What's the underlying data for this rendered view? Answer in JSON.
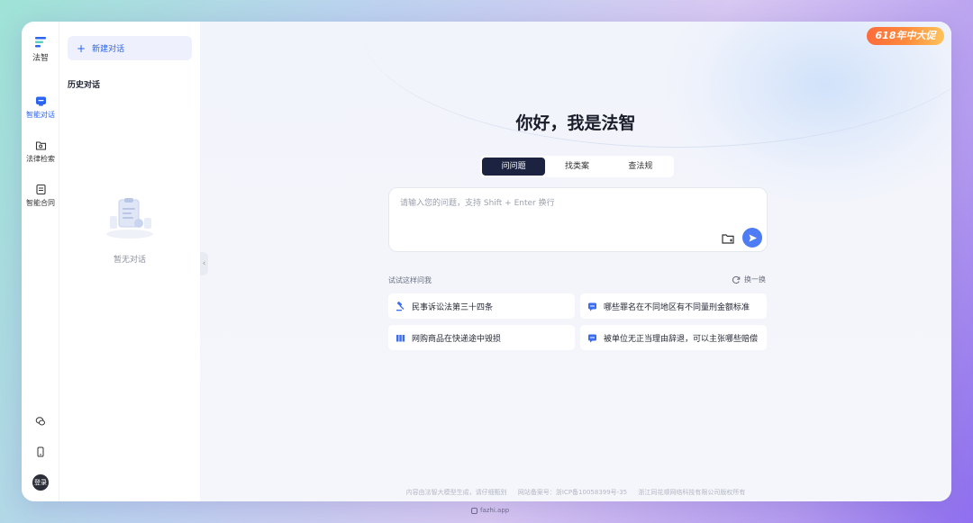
{
  "rail": {
    "logo_label": "法智",
    "items": [
      {
        "label": "智能对话"
      },
      {
        "label": "法律检索"
      },
      {
        "label": "智能合同"
      }
    ],
    "login_label": "登录"
  },
  "history": {
    "new_chat_label": "新建对话",
    "title": "历史对话",
    "empty_text": "暂无对话"
  },
  "promo": {
    "label": "618年中大促"
  },
  "main": {
    "greeting": "你好，我是法智",
    "tabs": [
      {
        "label": "问问题",
        "active": true
      },
      {
        "label": "找类案",
        "active": false
      },
      {
        "label": "查法规",
        "active": false
      }
    ],
    "input_placeholder": "请输入您的问题，支持 Shift + Enter 换行",
    "try_label": "试试这样问我",
    "refresh_label": "换一换",
    "suggestions": [
      {
        "label": "民事诉讼法第三十四条",
        "icon": "gavel-icon"
      },
      {
        "label": "哪些罪名在不同地区有不同量刑金额标准",
        "icon": "chat-icon"
      },
      {
        "label": "网购商品在快递途中毁损",
        "icon": "books-icon"
      },
      {
        "label": "被单位无正当理由辞退，可以主张哪些赔偿",
        "icon": "chat-icon"
      }
    ],
    "footer": {
      "disclaimer": "内容由法智大模型生成，请仔细甄别",
      "icp": "网站备案号：浙ICP备10058399号-35",
      "copyright": "浙江同花顺网络科技有限公司版权所有"
    }
  },
  "bottom_url": "fazhi.app",
  "colors": {
    "accent": "#2a64f0",
    "send": "#4d7cf5",
    "tab_active": "#1c2340",
    "promo": "#ff6b3a"
  }
}
